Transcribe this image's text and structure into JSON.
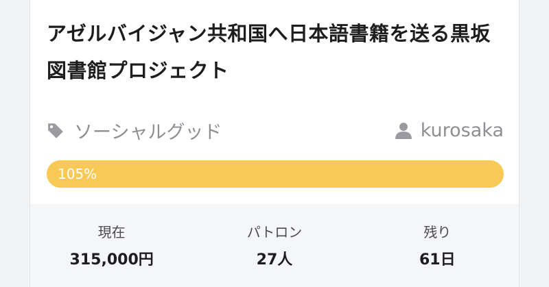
{
  "project": {
    "title": "アゼルバイジャン共和国へ日本語書籍を送る黒坂図書館プロジェクト",
    "category": "ソーシャルグッド",
    "owner": "kurosaka",
    "progress_label": "105%",
    "progress_value": 1.05
  },
  "stats": [
    {
      "label": "現在",
      "value": "315,000円"
    },
    {
      "label": "パトロン",
      "value": "27人"
    },
    {
      "label": "残り",
      "value": "61日"
    }
  ],
  "colors": {
    "progress": "#f8c956",
    "muted_text": "#8e8e93",
    "stats_background": "#f5f6f8"
  },
  "icons": {
    "category": "tag-icon",
    "owner": "user-icon"
  }
}
